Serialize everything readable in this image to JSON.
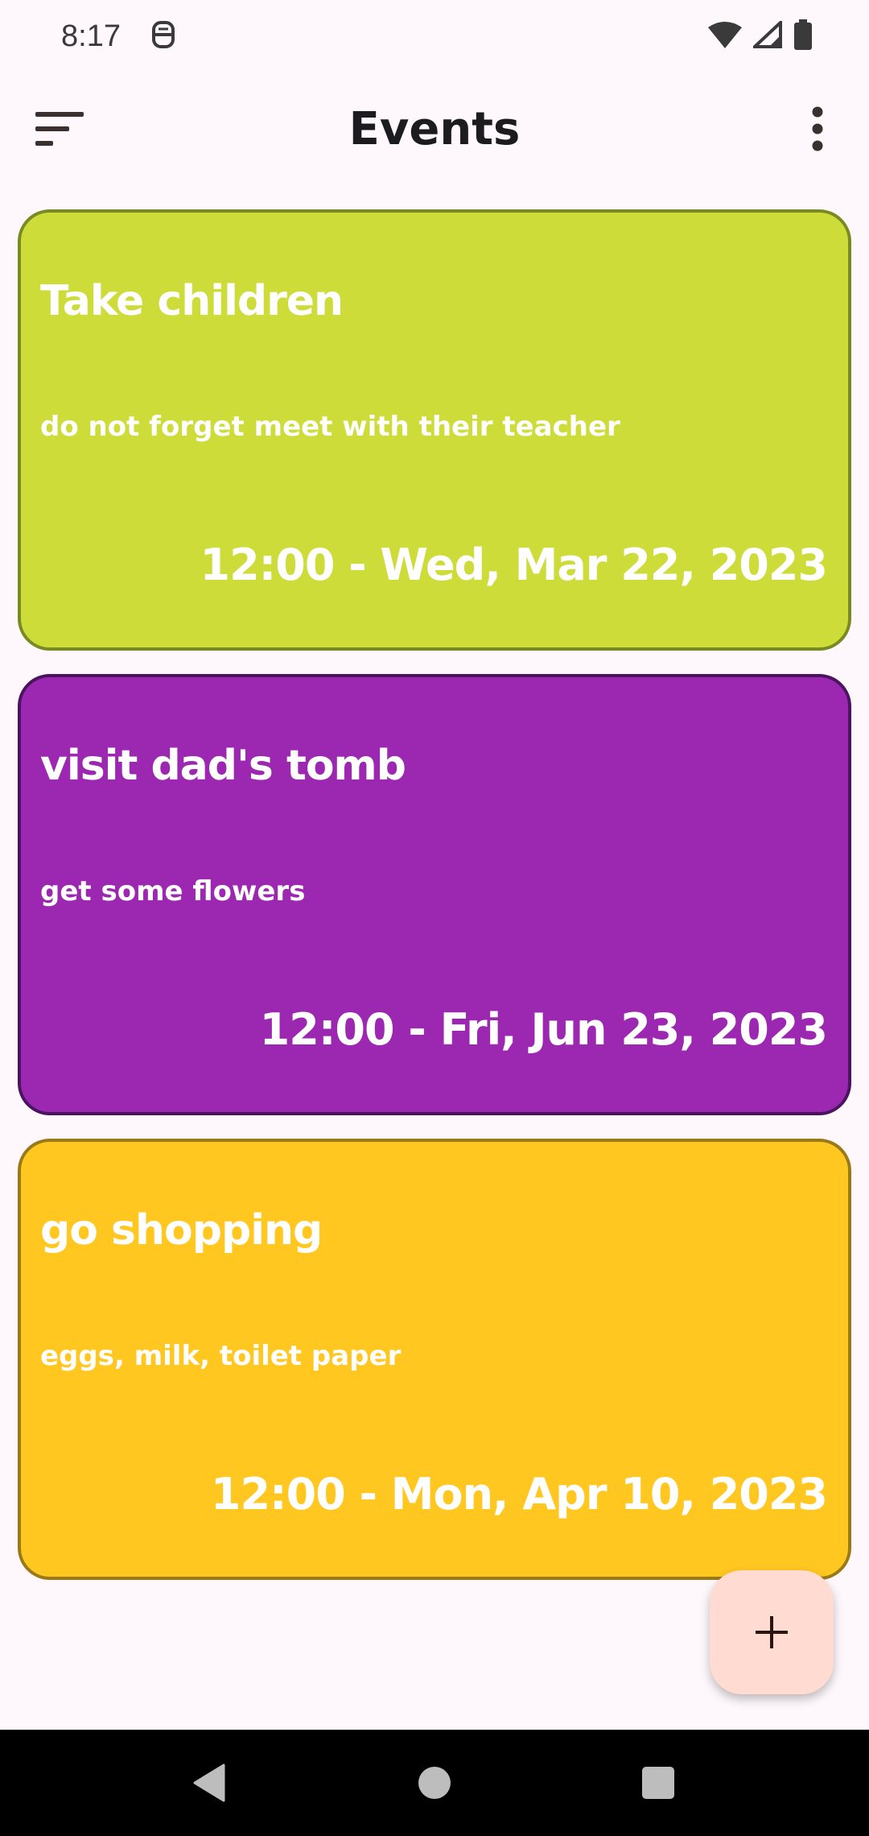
{
  "status_bar": {
    "time": "8:17"
  },
  "app_bar": {
    "title": "Events"
  },
  "events": [
    {
      "title": "Take children",
      "description": "do not forget meet with their teacher",
      "datetime": "12:00 - Wed, Mar 22, 2023",
      "color": "#CDDC39",
      "border_color": "#7A8A22"
    },
    {
      "title": "visit dad's tomb",
      "description": "get some flowers",
      "datetime": "12:00 - Fri, Jun 23, 2023",
      "color": "#9C27B0",
      "border_color": "#4A1460"
    },
    {
      "title": "go shopping",
      "description": "eggs, milk, toilet paper",
      "datetime": "12:00 - Mon, Apr 10, 2023",
      "color": "#FFC720",
      "border_color": "#9A7A18"
    }
  ],
  "fab": {
    "icon": "plus-icon",
    "background": "#FFDBD1"
  },
  "nav": {
    "back_icon": "back-triangle-icon",
    "home_icon": "home-circle-icon",
    "recents_icon": "recents-square-icon"
  }
}
